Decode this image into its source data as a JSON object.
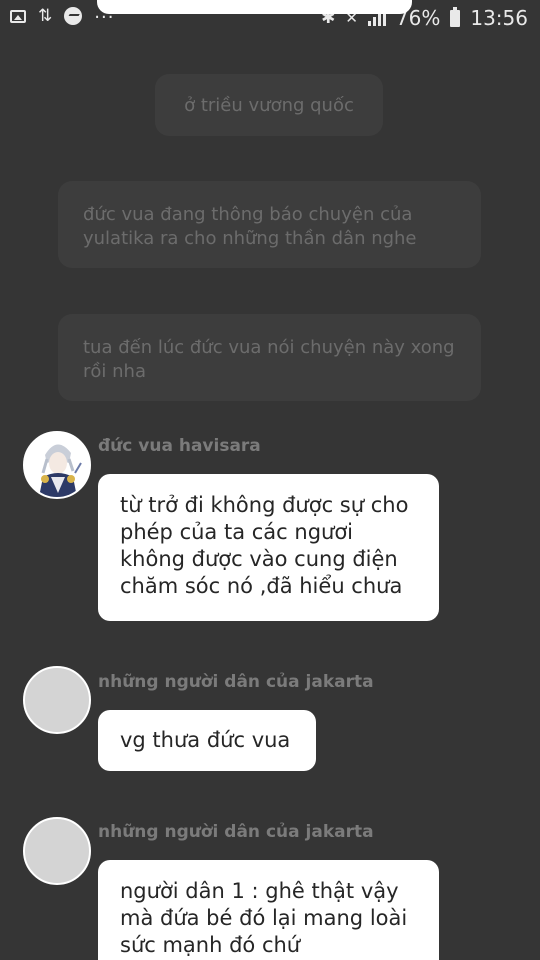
{
  "status_bar": {
    "left_icons": [
      "image-icon",
      "data-arrows-icon",
      "messenger-icon",
      "more-dots-icon"
    ],
    "more": "...",
    "battery": "76%",
    "time": "13:56"
  },
  "narrations": [
    "ở triều vương quốc",
    "đức vua đang thông báo chuyện của yulatika ra cho những thần dân nghe",
    "tua đến lúc đức vua nói chuyện này xong rồi nha"
  ],
  "messages": [
    {
      "sender": "đức vua havisara",
      "avatar": "king-avatar",
      "text": "từ trở đi không được sự cho phép của ta các ngươi không được vào cung điện chăm sóc nó ,đã hiểu chưa"
    },
    {
      "sender": "những người dân của jakarta",
      "avatar": "default-avatar",
      "text": "vg thưa đức vua"
    },
    {
      "sender": "những người dân của jakarta",
      "avatar": "default-avatar",
      "text": "người dân 1 :  ghê thật vậy mà đứa bé đó lại mang loài sức mạnh đó chứ"
    }
  ],
  "colors": {
    "background": "#353535",
    "narration_box": "#3d3d3d",
    "narration_text": "#6c6c6c",
    "sender_text": "#7b7b7b",
    "bubble": "#ffffff"
  }
}
